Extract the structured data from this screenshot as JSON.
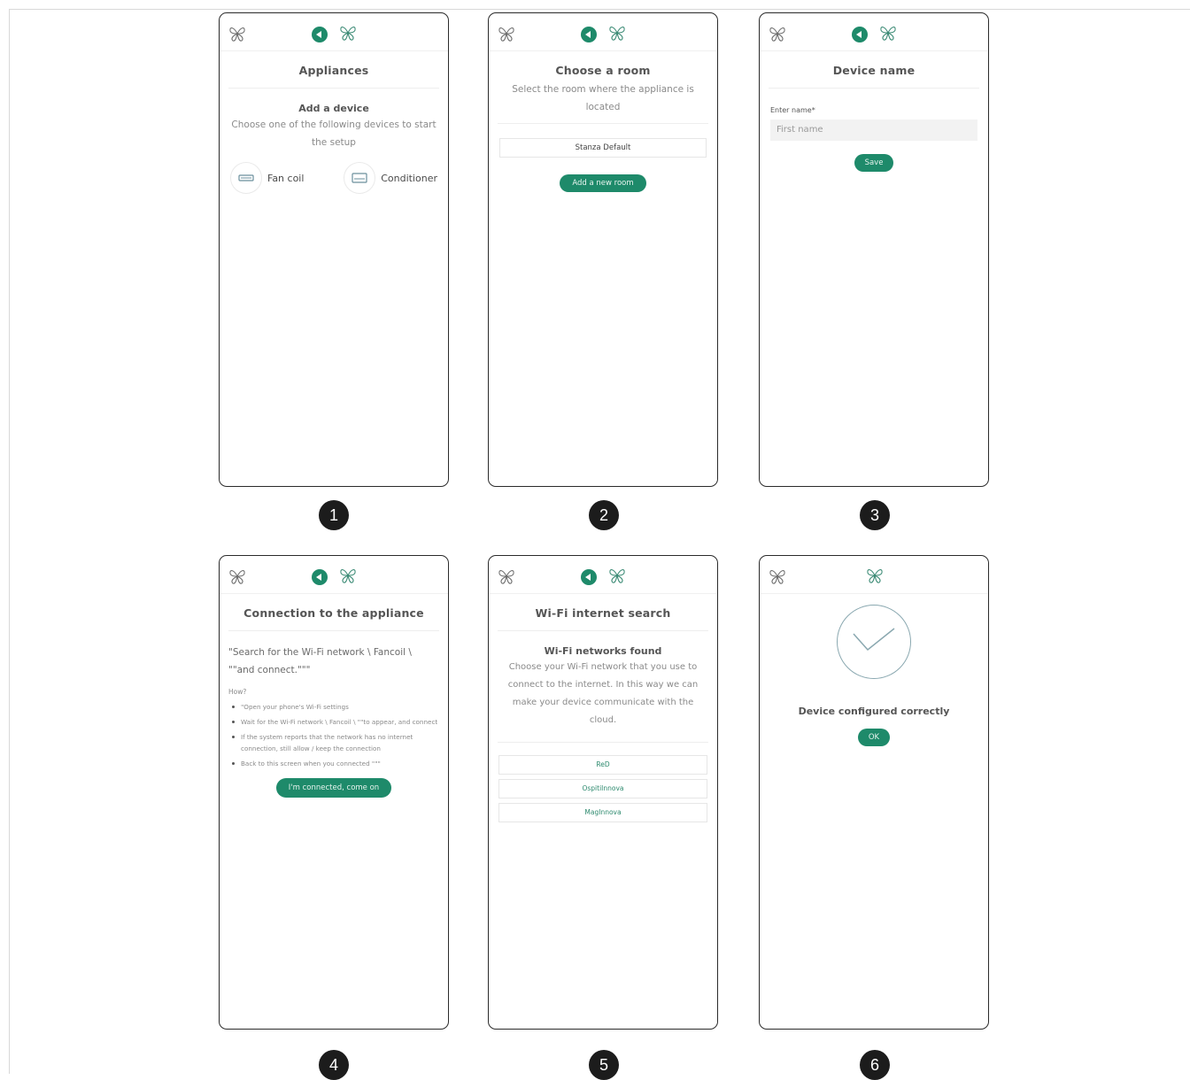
{
  "badges": [
    "1",
    "2",
    "3",
    "4",
    "5",
    "6"
  ],
  "screen1": {
    "title": "Appliances",
    "subtitle": "Add a device",
    "description": "Choose one of the following devices to start the setup",
    "devices": [
      {
        "label": "Fan coil",
        "icon": "fan-coil-icon"
      },
      {
        "label": "Conditioner",
        "icon": "conditioner-icon"
      }
    ]
  },
  "screen2": {
    "title": "Choose a room",
    "description": "Select the room where the appliance is located",
    "room": "Stanza Default",
    "add_button": "Add a new room"
  },
  "screen3": {
    "title": "Device name",
    "field_label": "Enter name*",
    "field_placeholder": "First name",
    "save_button": "Save"
  },
  "screen4": {
    "title": "Connection to the appliance",
    "instruction": "\"Search for the Wi-Fi network \\ Fancoil \\ \"\"and connect.\"\"\"",
    "how_label": "How?",
    "steps": [
      "\"Open your phone's Wi-Fi settings",
      "Wait for the Wi-Fi network \\ Fancoil \\ \"\"to appear, and connect",
      "If the system reports that the network has no internet connection, still allow / keep the connection",
      "Back to this screen when you connected \"\"\""
    ],
    "connect_button": "I'm connected, come on"
  },
  "screen5": {
    "title": "Wi-Fi internet search",
    "subtitle": "Wi-Fi networks found",
    "description": "Choose your Wi-Fi network that you use to connect to the internet. In this way we can make your device communicate with the cloud.",
    "networks": [
      "ReD",
      "OspitiInnova",
      "MagInnova"
    ]
  },
  "screen6": {
    "message": "Device configured correctly",
    "ok_button": "OK"
  },
  "colors": {
    "accent": "#1e8a6a",
    "border": "#2b2b2b",
    "badge": "#1c1c1c"
  }
}
